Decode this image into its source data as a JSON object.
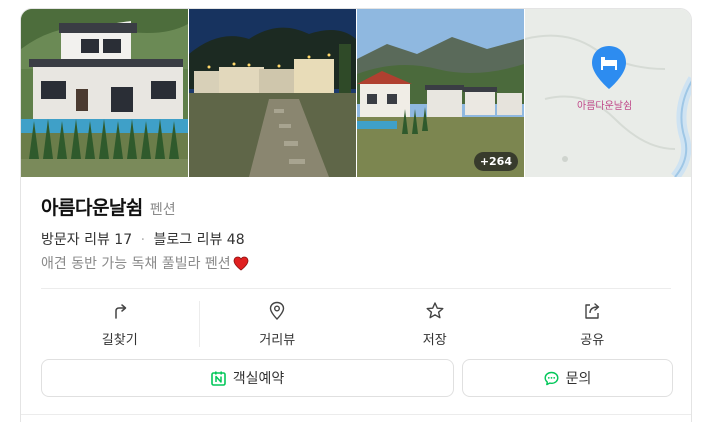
{
  "place": {
    "name": "아름다운날쉼",
    "category": "펜션",
    "visitor_reviews": "방문자 리뷰 17",
    "separator": "·",
    "blog_reviews": "블로그 리뷰 48",
    "description": "애견 동반 가능 독채 풀빌라 펜션"
  },
  "photos": {
    "more_count": "+264"
  },
  "map": {
    "marker_label": "아름다운날쉼",
    "pin_color": "#2d8cf0"
  },
  "actions": [
    {
      "label": "길찾기",
      "icon": "directions-icon"
    },
    {
      "label": "거리뷰",
      "icon": "location-pin-icon"
    },
    {
      "label": "저장",
      "icon": "star-icon"
    },
    {
      "label": "공유",
      "icon": "share-icon"
    }
  ],
  "buttons": {
    "booking": "객실예약",
    "inquiry": "문의"
  },
  "colors": {
    "accent_green": "#03c75a",
    "heart_red": "#e02020"
  }
}
